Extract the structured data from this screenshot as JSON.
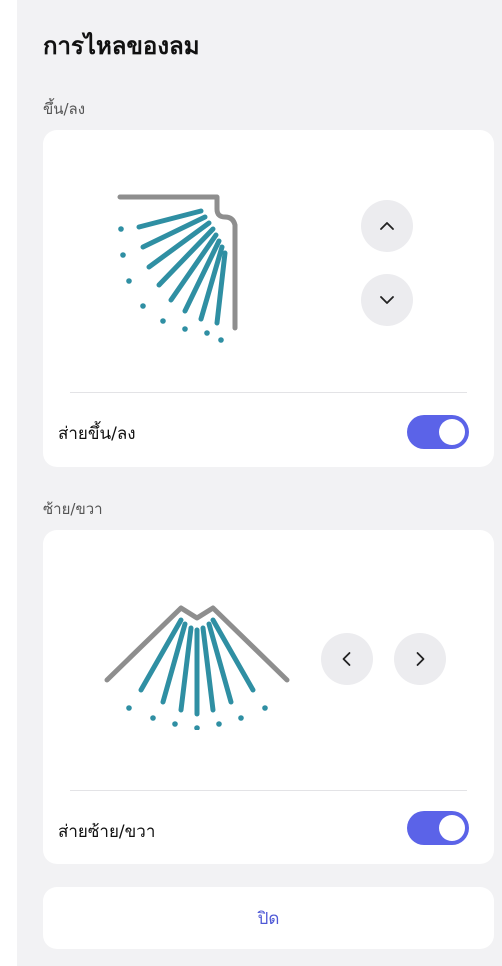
{
  "header": {
    "title": "การไหลของลม"
  },
  "vertical": {
    "section_label": "ขึ้น/ลง",
    "swing_label": "ส่ายขึ้น/ลง",
    "swing_on": true,
    "up_icon": "chevron-up-icon",
    "down_icon": "chevron-down-icon"
  },
  "horizontal": {
    "section_label": "ซ้าย/ขวา",
    "swing_label": "ส่ายซ้าย/ขวา",
    "swing_on": true,
    "left_icon": "chevron-left-icon",
    "right_icon": "chevron-right-icon"
  },
  "footer": {
    "close_label": "ปิด"
  },
  "colors": {
    "accent": "#5b63e8",
    "airflow": "#2f8fa3",
    "vane": "#8e8e8e",
    "close_text": "#4f59d6"
  }
}
